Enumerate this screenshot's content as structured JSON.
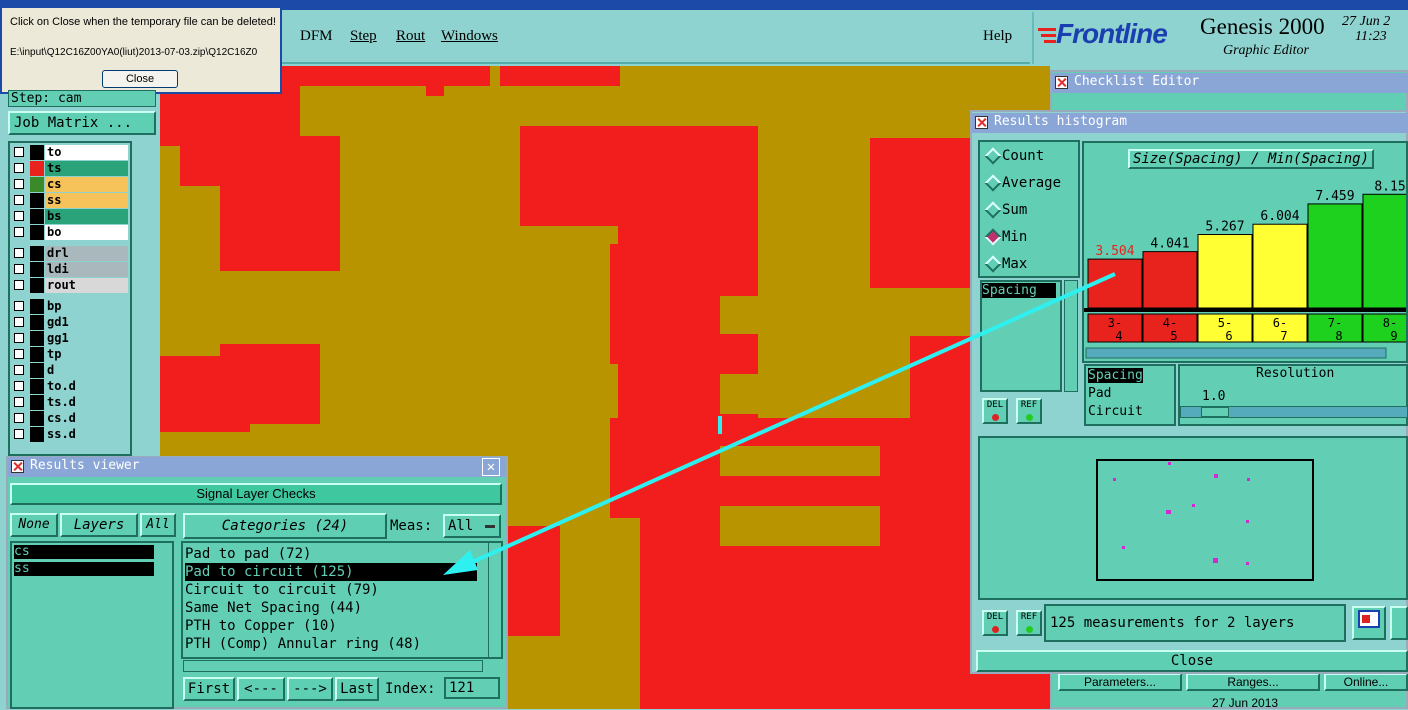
{
  "main_menu": {
    "items": [
      "DFM",
      "Step",
      "Rout",
      "Windows"
    ],
    "help": "Help"
  },
  "brand": {
    "logo": "Frontline",
    "product": "Genesis 2000",
    "subtitle": "Graphic Editor",
    "date": "27 Jun 2",
    "time": "11:23"
  },
  "popup": {
    "message": "Click on Close when the temporary file can be deleted!",
    "path": "E:\\input\\Q12C16Z00YA0(liut)2013-07-03.zip\\Q12C16Z0",
    "close_label": "Close"
  },
  "left_panel": {
    "step": "Step: cam",
    "job_matrix": "Job Matrix ...",
    "layers": [
      {
        "name": "to",
        "color": "#ffffff",
        "swatch": "#000000"
      },
      {
        "name": "ts",
        "color": "#2aa37a",
        "swatch": "#e8231e"
      },
      {
        "name": "cs",
        "color": "#f5c35a",
        "swatch": "#3a8a2a"
      },
      {
        "name": "ss",
        "color": "#f5c35a",
        "swatch": "#000000"
      },
      {
        "name": "bs",
        "color": "#2aa37a",
        "swatch": "#000000"
      },
      {
        "name": "bo",
        "color": "#ffffff",
        "swatch": "#000000"
      },
      {
        "name": "drl",
        "color": "#a8b8bc",
        "swatch": "#000000"
      },
      {
        "name": "ldi",
        "color": "#a8b8bc",
        "swatch": "#000000"
      },
      {
        "name": "rout",
        "color": "#d8d8d8",
        "swatch": "#000000"
      },
      {
        "name": "bp",
        "color": "#8ed3cf",
        "swatch": "#000000"
      },
      {
        "name": "gd1",
        "color": "#8ed3cf",
        "swatch": "#000000"
      },
      {
        "name": "gg1",
        "color": "#8ed3cf",
        "swatch": "#000000"
      },
      {
        "name": "tp",
        "color": "#8ed3cf",
        "swatch": "#000000"
      },
      {
        "name": "d",
        "color": "#8ed3cf",
        "swatch": "#000000"
      },
      {
        "name": "to.d",
        "color": "#8ed3cf",
        "swatch": "#000000"
      },
      {
        "name": "ts.d",
        "color": "#8ed3cf",
        "swatch": "#000000"
      },
      {
        "name": "cs.d",
        "color": "#8ed3cf",
        "swatch": "#000000"
      },
      {
        "name": "ss.d",
        "color": "#8ed3cf",
        "swatch": "#000000"
      }
    ]
  },
  "results_viewer": {
    "title": "Results viewer",
    "header": "Signal Layer Checks",
    "none": "None",
    "layers": "Layers",
    "all": "All",
    "categories_label": "Categories (24)",
    "meas_label": "Meas:",
    "meas_value": "All",
    "layer_list": [
      "cs",
      "ss"
    ],
    "categories": [
      "Pad to pad (72)",
      "Pad to circuit (125)",
      "Circuit to circuit (79)",
      "Same Net Spacing (44)",
      "PTH to Copper (10)",
      "PTH (Comp) Annular ring (48)"
    ],
    "nav": {
      "first": "First",
      "prev": "<---",
      "next": "--->",
      "last": "Last",
      "index_label": "Index:",
      "index_value": "121"
    }
  },
  "checklist_editor": {
    "title": "Checklist Editor",
    "parameters": "Parameters...",
    "ranges": "Ranges...",
    "online": "Online...",
    "date": "27 Jun 2013"
  },
  "histogram": {
    "title": "Results histogram",
    "modes": [
      "Count",
      "Average",
      "Sum",
      "Min",
      "Max"
    ],
    "selected_mode": "Min",
    "measure_list_top": [
      "Spacing"
    ],
    "chart_title": "Size(Spacing) / Min(Spacing)",
    "del": "DEL",
    "ref": "REF",
    "filter_list": [
      "Spacing",
      "Pad",
      "Circuit"
    ],
    "resolution_label": "Resolution",
    "resolution_value": "1.0",
    "status": "125 measurements for 2 layers",
    "close": "Close"
  },
  "chart_data": {
    "type": "bar",
    "title": "Size(Spacing) / Min(Spacing)",
    "categories": [
      "3-4",
      "4-5",
      "5-6",
      "6-7",
      "7-8",
      "8-9"
    ],
    "values": [
      3.504,
      4.041,
      5.267,
      6.004,
      7.459,
      8.15
    ],
    "colors": [
      "#e8231e",
      "#e8231e",
      "#ffff33",
      "#ffff33",
      "#1fd11f",
      "#1fd11f"
    ]
  }
}
